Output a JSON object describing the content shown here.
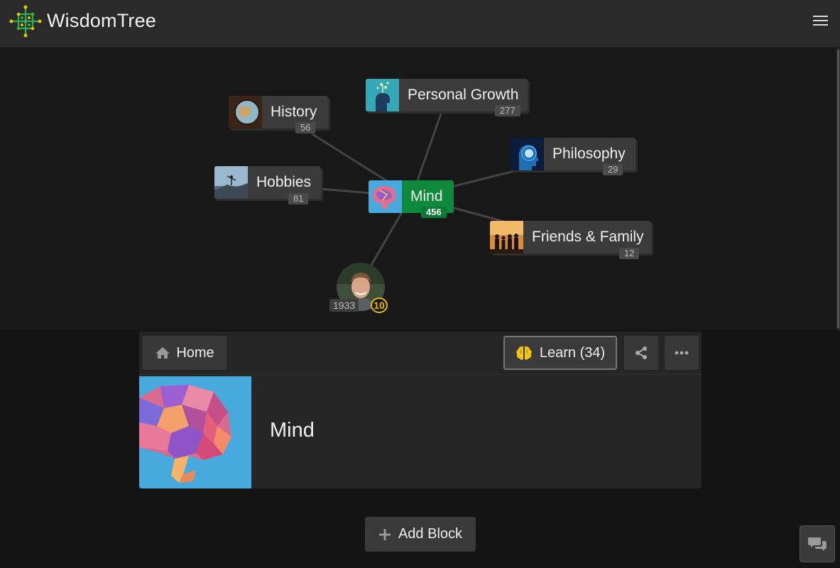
{
  "header": {
    "brand": "WisdomTree",
    "menu_icon": "hamburger-icon"
  },
  "graph": {
    "center": {
      "label": "Mind",
      "count": "456"
    },
    "nodes": [
      {
        "label": "Personal Growth",
        "count": "277"
      },
      {
        "label": "History",
        "count": "56"
      },
      {
        "label": "Philosophy",
        "count": "29"
      },
      {
        "label": "Hobbies",
        "count": "81"
      },
      {
        "label": "Friends & Family",
        "count": "12"
      }
    ],
    "user": {
      "points": "1933",
      "level": "10"
    }
  },
  "toolbar": {
    "home_label": "Home",
    "learn_label": "Learn (34)",
    "share_icon": "share-icon",
    "more_icon": "more-icon"
  },
  "block": {
    "title": "Mind"
  },
  "add_block_label": "Add Block",
  "colors": {
    "accent_green": "#0f8a3c",
    "level_gold": "#e6b800",
    "hero_blue": "#48a9dd"
  }
}
